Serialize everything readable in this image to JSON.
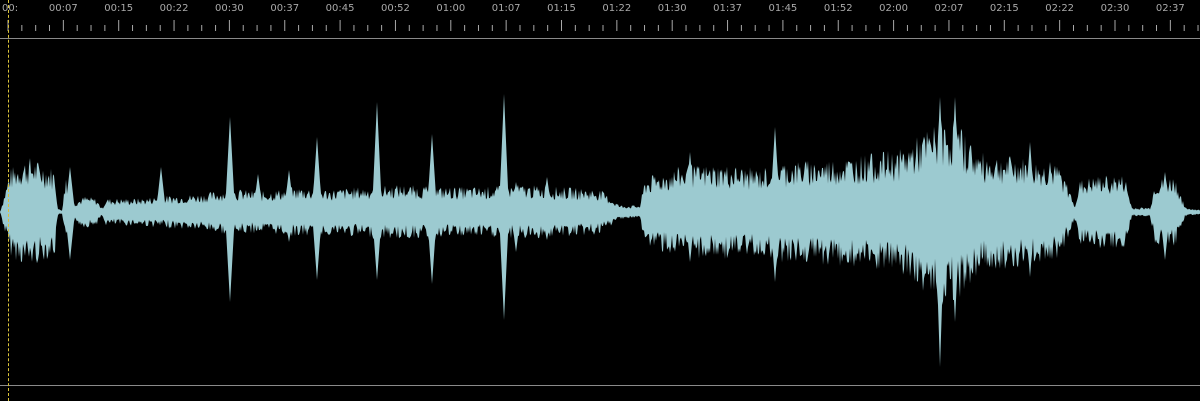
{
  "timeline": {
    "tick_labels": [
      "00:",
      "00:07",
      "00:15",
      "00:22",
      "00:30",
      "00:37",
      "00:45",
      "00:52",
      "01:00",
      "01:07",
      "01:15",
      "01:22",
      "01:30",
      "01:37",
      "01:45",
      "01:52",
      "02:00",
      "02:07",
      "02:15",
      "02:22",
      "02:30",
      "02:37"
    ]
  },
  "colors": {
    "waveform": "#9ccad0",
    "background": "#000000",
    "ruler_text": "#a9a9a9",
    "divider": "#8a8a8a",
    "playhead": "#d9c23a"
  },
  "icons": {
    "playhead": "playhead-marker"
  }
}
